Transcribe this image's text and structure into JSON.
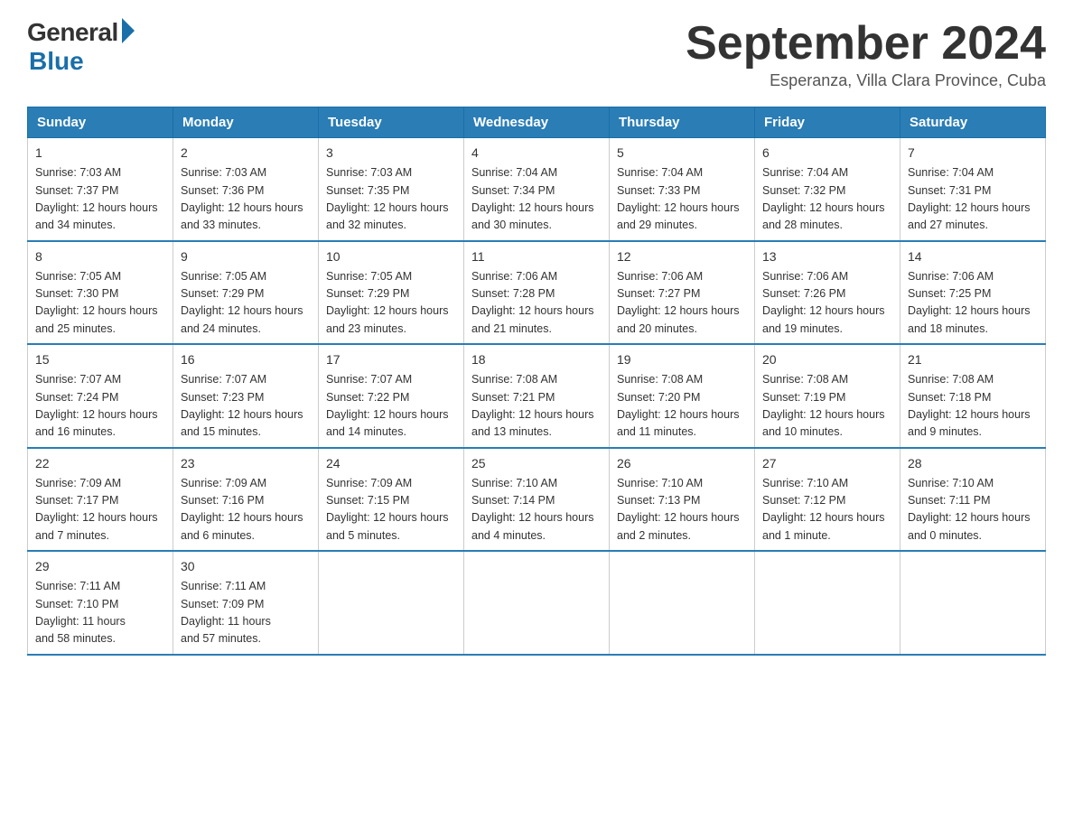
{
  "header": {
    "title": "September 2024",
    "subtitle": "Esperanza, Villa Clara Province, Cuba",
    "logo_general": "General",
    "logo_blue": "Blue"
  },
  "days_of_week": [
    "Sunday",
    "Monday",
    "Tuesday",
    "Wednesday",
    "Thursday",
    "Friday",
    "Saturday"
  ],
  "weeks": [
    [
      {
        "day": "1",
        "sunrise": "7:03 AM",
        "sunset": "7:37 PM",
        "daylight": "12 hours and 34 minutes."
      },
      {
        "day": "2",
        "sunrise": "7:03 AM",
        "sunset": "7:36 PM",
        "daylight": "12 hours and 33 minutes."
      },
      {
        "day": "3",
        "sunrise": "7:03 AM",
        "sunset": "7:35 PM",
        "daylight": "12 hours and 32 minutes."
      },
      {
        "day": "4",
        "sunrise": "7:04 AM",
        "sunset": "7:34 PM",
        "daylight": "12 hours and 30 minutes."
      },
      {
        "day": "5",
        "sunrise": "7:04 AM",
        "sunset": "7:33 PM",
        "daylight": "12 hours and 29 minutes."
      },
      {
        "day": "6",
        "sunrise": "7:04 AM",
        "sunset": "7:32 PM",
        "daylight": "12 hours and 28 minutes."
      },
      {
        "day": "7",
        "sunrise": "7:04 AM",
        "sunset": "7:31 PM",
        "daylight": "12 hours and 27 minutes."
      }
    ],
    [
      {
        "day": "8",
        "sunrise": "7:05 AM",
        "sunset": "7:30 PM",
        "daylight": "12 hours and 25 minutes."
      },
      {
        "day": "9",
        "sunrise": "7:05 AM",
        "sunset": "7:29 PM",
        "daylight": "12 hours and 24 minutes."
      },
      {
        "day": "10",
        "sunrise": "7:05 AM",
        "sunset": "7:29 PM",
        "daylight": "12 hours and 23 minutes."
      },
      {
        "day": "11",
        "sunrise": "7:06 AM",
        "sunset": "7:28 PM",
        "daylight": "12 hours and 21 minutes."
      },
      {
        "day": "12",
        "sunrise": "7:06 AM",
        "sunset": "7:27 PM",
        "daylight": "12 hours and 20 minutes."
      },
      {
        "day": "13",
        "sunrise": "7:06 AM",
        "sunset": "7:26 PM",
        "daylight": "12 hours and 19 minutes."
      },
      {
        "day": "14",
        "sunrise": "7:06 AM",
        "sunset": "7:25 PM",
        "daylight": "12 hours and 18 minutes."
      }
    ],
    [
      {
        "day": "15",
        "sunrise": "7:07 AM",
        "sunset": "7:24 PM",
        "daylight": "12 hours and 16 minutes."
      },
      {
        "day": "16",
        "sunrise": "7:07 AM",
        "sunset": "7:23 PM",
        "daylight": "12 hours and 15 minutes."
      },
      {
        "day": "17",
        "sunrise": "7:07 AM",
        "sunset": "7:22 PM",
        "daylight": "12 hours and 14 minutes."
      },
      {
        "day": "18",
        "sunrise": "7:08 AM",
        "sunset": "7:21 PM",
        "daylight": "12 hours and 13 minutes."
      },
      {
        "day": "19",
        "sunrise": "7:08 AM",
        "sunset": "7:20 PM",
        "daylight": "12 hours and 11 minutes."
      },
      {
        "day": "20",
        "sunrise": "7:08 AM",
        "sunset": "7:19 PM",
        "daylight": "12 hours and 10 minutes."
      },
      {
        "day": "21",
        "sunrise": "7:08 AM",
        "sunset": "7:18 PM",
        "daylight": "12 hours and 9 minutes."
      }
    ],
    [
      {
        "day": "22",
        "sunrise": "7:09 AM",
        "sunset": "7:17 PM",
        "daylight": "12 hours and 7 minutes."
      },
      {
        "day": "23",
        "sunrise": "7:09 AM",
        "sunset": "7:16 PM",
        "daylight": "12 hours and 6 minutes."
      },
      {
        "day": "24",
        "sunrise": "7:09 AM",
        "sunset": "7:15 PM",
        "daylight": "12 hours and 5 minutes."
      },
      {
        "day": "25",
        "sunrise": "7:10 AM",
        "sunset": "7:14 PM",
        "daylight": "12 hours and 4 minutes."
      },
      {
        "day": "26",
        "sunrise": "7:10 AM",
        "sunset": "7:13 PM",
        "daylight": "12 hours and 2 minutes."
      },
      {
        "day": "27",
        "sunrise": "7:10 AM",
        "sunset": "7:12 PM",
        "daylight": "12 hours and 1 minute."
      },
      {
        "day": "28",
        "sunrise": "7:10 AM",
        "sunset": "7:11 PM",
        "daylight": "12 hours and 0 minutes."
      }
    ],
    [
      {
        "day": "29",
        "sunrise": "7:11 AM",
        "sunset": "7:10 PM",
        "daylight": "11 hours and 58 minutes."
      },
      {
        "day": "30",
        "sunrise": "7:11 AM",
        "sunset": "7:09 PM",
        "daylight": "11 hours and 57 minutes."
      },
      null,
      null,
      null,
      null,
      null
    ]
  ],
  "labels": {
    "sunrise": "Sunrise:",
    "sunset": "Sunset:",
    "daylight": "Daylight:"
  }
}
